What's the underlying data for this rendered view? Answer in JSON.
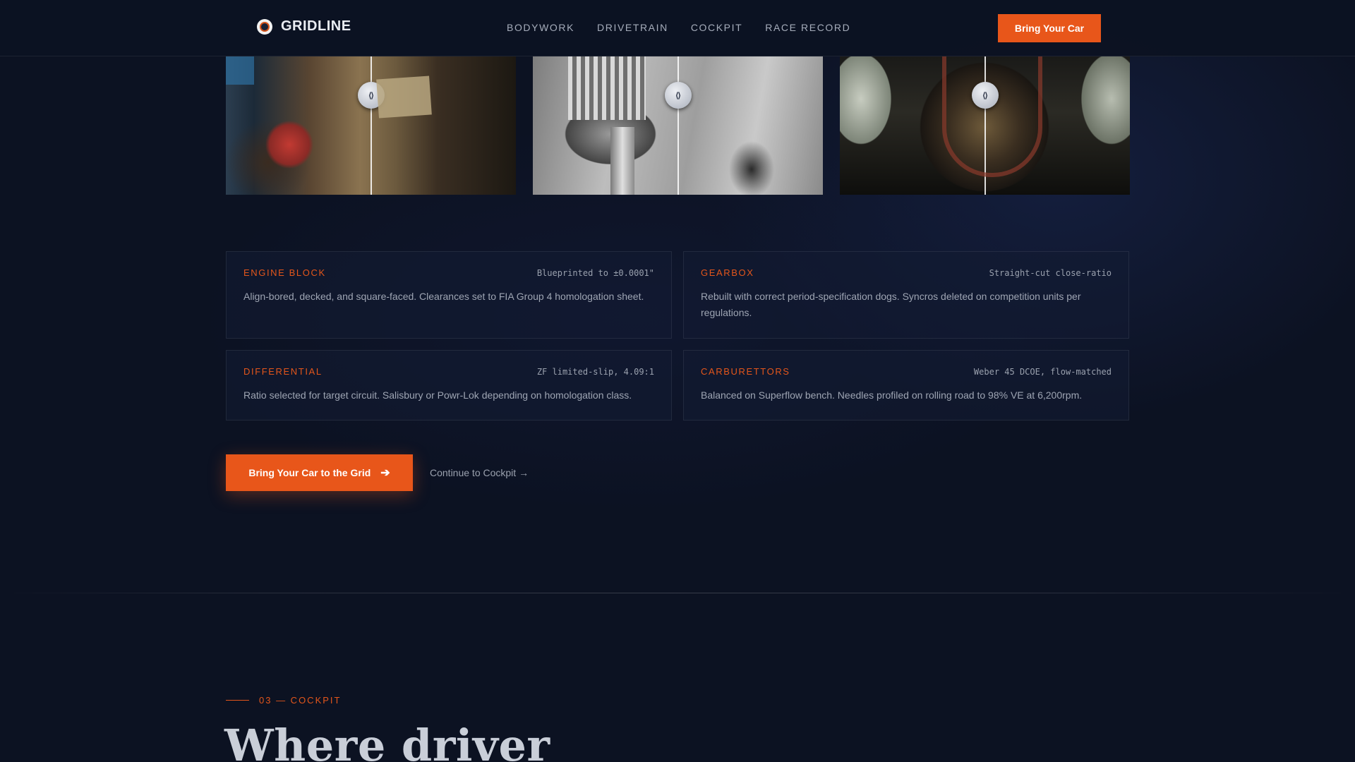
{
  "nav": {
    "brand": "GRIDLINE",
    "links": [
      "BODYWORK",
      "DRIVETRAIN",
      "COCKPIT",
      "RACE RECORD"
    ],
    "cta": "Bring Your Car"
  },
  "gallery": {
    "handle_glyph": "⟨⟩",
    "items": [
      "engine-block-comparison",
      "gearbox-comparison",
      "differential-comparison"
    ]
  },
  "specs": [
    {
      "title": "ENGINE BLOCK",
      "meta": "Blueprinted to ±0.0001\"",
      "desc": "Align-bored, decked, and square-faced. Clearances set to FIA Group 4 homologation sheet."
    },
    {
      "title": "GEARBOX",
      "meta": "Straight-cut close-ratio",
      "desc": "Rebuilt with correct period-specification dogs. Syncros deleted on competition units per regulations."
    },
    {
      "title": "DIFFERENTIAL",
      "meta": "ZF limited-slip, 4.09:1",
      "desc": "Ratio selected for target circuit. Salisbury or Powr-Lok depending on homologation class."
    },
    {
      "title": "CARBURETTORS",
      "meta": "Weber 45 DCOE, flow-matched",
      "desc": "Balanced on Superflow bench. Needles profiled on rolling road to 98% VE at 6,200rpm."
    }
  ],
  "cta": {
    "primary": "Bring Your Car to the Grid",
    "primary_arrow": "➔",
    "secondary": "Continue to Cockpit →"
  },
  "next_section": {
    "eyebrow": "03 — COCKPIT",
    "heading": "Where driver"
  },
  "colors": {
    "accent": "#e8561a",
    "background": "#0c1222"
  }
}
